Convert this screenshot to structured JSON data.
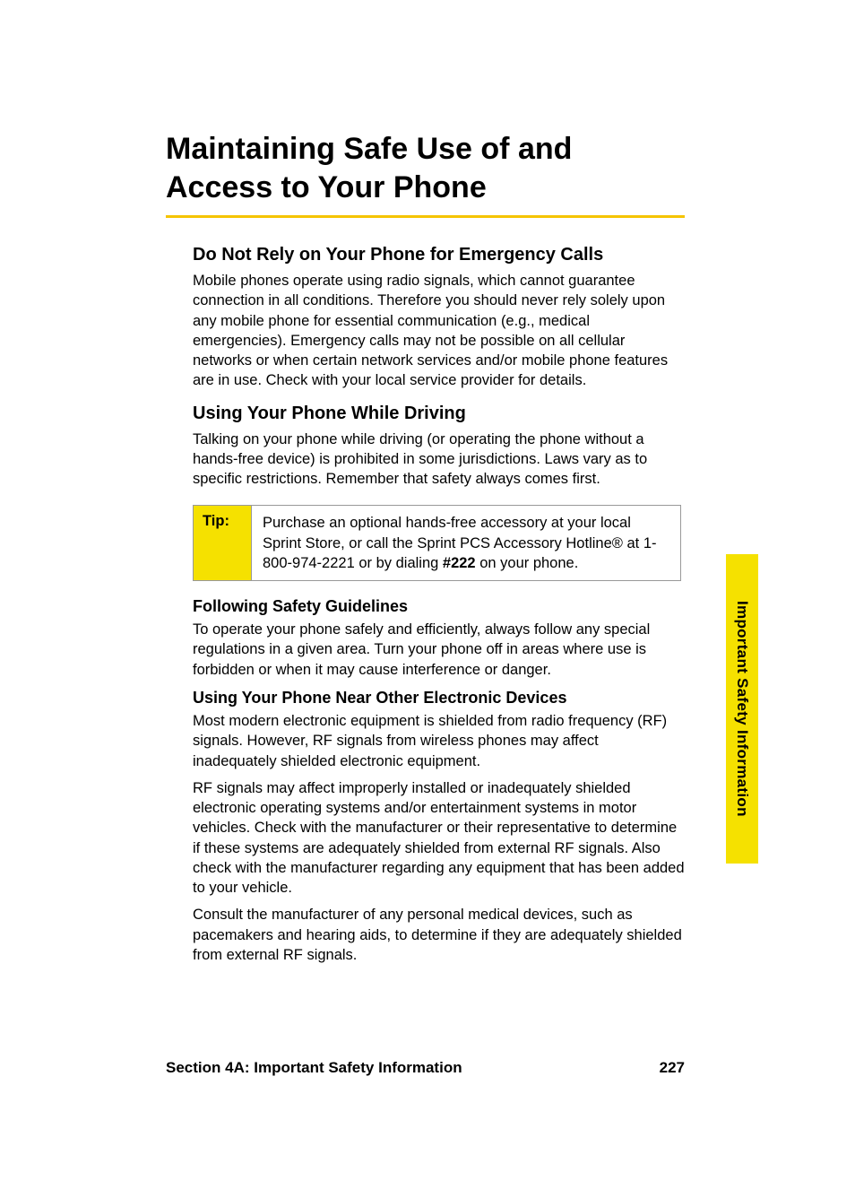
{
  "title": "Maintaining Safe Use of and Access to Your Phone",
  "sections": [
    {
      "heading": "Do Not Rely on Your Phone for Emergency Calls",
      "headingClass": "subheading",
      "paragraphs": [
        "Mobile phones operate using radio signals, which cannot guarantee connection in all conditions. Therefore you should never rely solely upon any mobile phone for essential communication (e.g., medical emergencies). Emergency calls may not be possible on all cellular networks or when certain network services and/or mobile phone features are in use. Check with your local service provider for details."
      ]
    },
    {
      "heading": "Using Your Phone While Driving",
      "headingClass": "subheading",
      "paragraphs": [
        "Talking on your phone while driving (or operating the phone without a hands-free device) is prohibited in some jurisdictions. Laws vary as to specific restrictions. Remember that safety always comes first."
      ]
    }
  ],
  "tip": {
    "label": "Tip:",
    "text_pre": "Purchase an optional hands-free accessory at your local Sprint Store, or call the Sprint PCS Accessory Hotline® at 1-800-974-2221 or by dialing ",
    "text_bold": "#222",
    "text_post": " on your phone."
  },
  "sections2": [
    {
      "heading": "Following Safety Guidelines",
      "headingClass": "subheading-small",
      "paragraphs": [
        "To operate your phone safely and efficiently, always follow any special regulations in a given area. Turn your phone off in areas where use is forbidden or when it may cause interference or danger."
      ]
    },
    {
      "heading": "Using Your Phone Near Other Electronic Devices",
      "headingClass": "subheading-small",
      "paragraphs": [
        "Most modern electronic equipment is shielded from radio frequency (RF) signals. However, RF signals from wireless phones may affect inadequately shielded electronic equipment.",
        "RF signals may affect improperly installed or inadequately shielded electronic operating systems and/or entertainment systems in motor vehicles. Check with the manufacturer or their representative to determine if these systems are adequately shielded from external RF signals. Also check with the manufacturer regarding any equipment that has been added to your vehicle.",
        "Consult the manufacturer of any personal medical devices, such as pacemakers and hearing aids, to determine if they are adequately shielded from external RF signals."
      ]
    }
  ],
  "sideTab": "Important Safety Information",
  "footer": {
    "left": "Section 4A: Important Safety Information",
    "right": "227"
  }
}
